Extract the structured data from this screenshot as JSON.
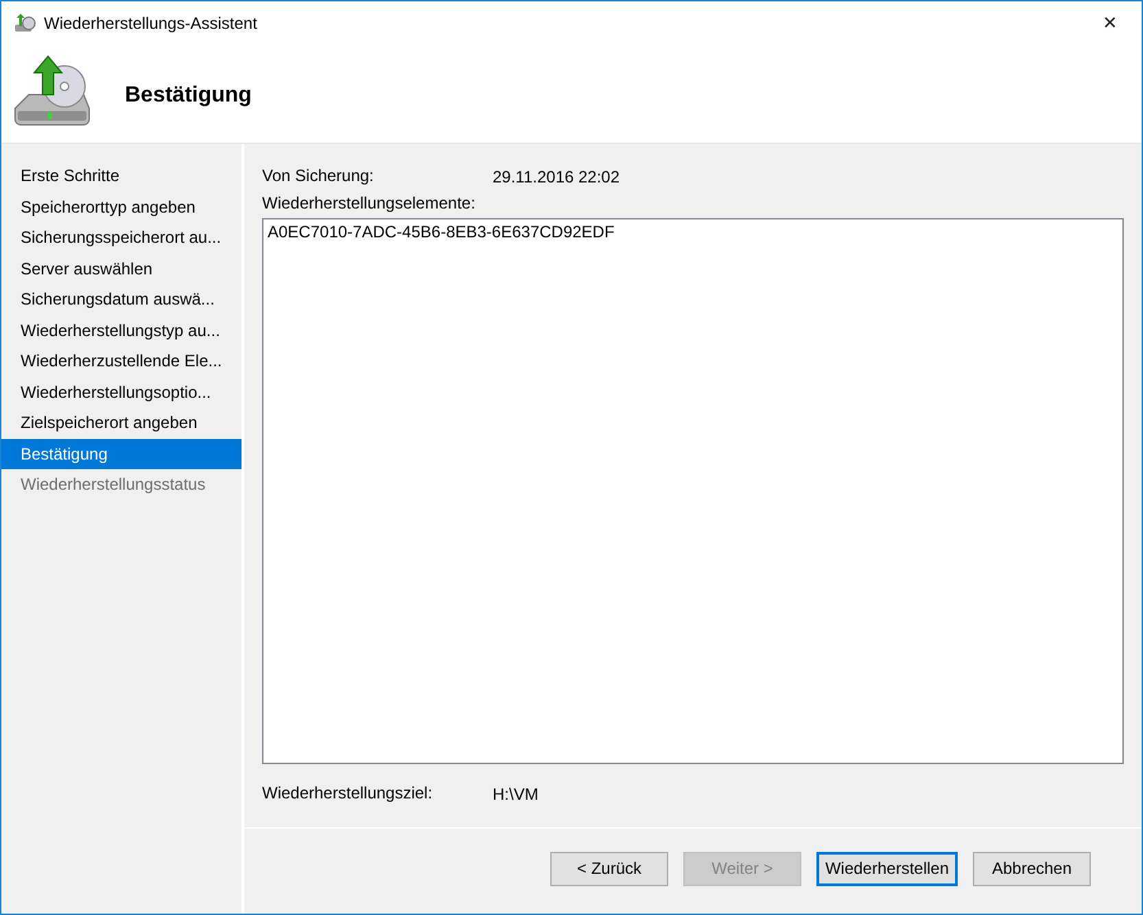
{
  "window": {
    "title": "Wiederherstellungs-Assistent",
    "close": "✕"
  },
  "header": {
    "title": "Bestätigung"
  },
  "steps": [
    {
      "label": "Erste Schritte",
      "selected": false,
      "disabled": false
    },
    {
      "label": "Speicherorttyp angeben",
      "selected": false,
      "disabled": false
    },
    {
      "label": "Sicherungsspeicherort au...",
      "selected": false,
      "disabled": false
    },
    {
      "label": "Server auswählen",
      "selected": false,
      "disabled": false
    },
    {
      "label": "Sicherungsdatum auswä...",
      "selected": false,
      "disabled": false
    },
    {
      "label": "Wiederherstellungstyp au...",
      "selected": false,
      "disabled": false
    },
    {
      "label": "Wiederherzustellende Ele...",
      "selected": false,
      "disabled": false
    },
    {
      "label": "Wiederherstellungsoptio...",
      "selected": false,
      "disabled": false
    },
    {
      "label": "Zielspeicherort angeben",
      "selected": false,
      "disabled": false
    },
    {
      "label": "Bestätigung",
      "selected": true,
      "disabled": false
    },
    {
      "label": "Wiederherstellungsstatus",
      "selected": false,
      "disabled": true
    }
  ],
  "summary": {
    "from_label": "Von Sicherung:",
    "from_value": "29.11.2016 22:02",
    "items_label": "Wiederherstellungselemente:",
    "items": [
      "A0EC7010-7ADC-45B6-8EB3-6E637CD92EDF"
    ],
    "target_label": "Wiederherstellungsziel:",
    "target_value": "H:\\VM"
  },
  "buttons": [
    {
      "label": "< Zurück",
      "disabled": false,
      "default": false
    },
    {
      "label": "Weiter >",
      "disabled": true,
      "default": false
    },
    {
      "label": "Wiederherstellen",
      "disabled": false,
      "default": true
    },
    {
      "label": "Abbrechen",
      "disabled": false,
      "default": false
    }
  ]
}
